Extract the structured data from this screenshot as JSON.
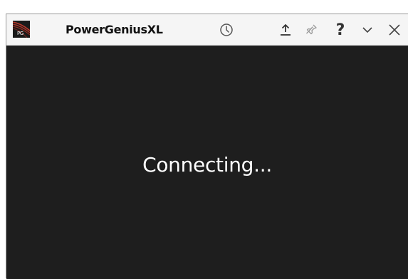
{
  "titlebar": {
    "logo_text": "PG",
    "app_title": "PowerGeniusXL",
    "icons": {
      "history": "clock-icon",
      "upload": "upload-icon",
      "pin": "pin-icon",
      "help": "help-icon",
      "minimize": "chevron-down-icon",
      "close": "close-icon"
    },
    "help_label": "?"
  },
  "content": {
    "status": "Connecting..."
  },
  "colors": {
    "background": "#1e1e1e",
    "titlebar": "#f5f5f5",
    "logo_accent": "#c0392b",
    "text": "#ffffff"
  }
}
